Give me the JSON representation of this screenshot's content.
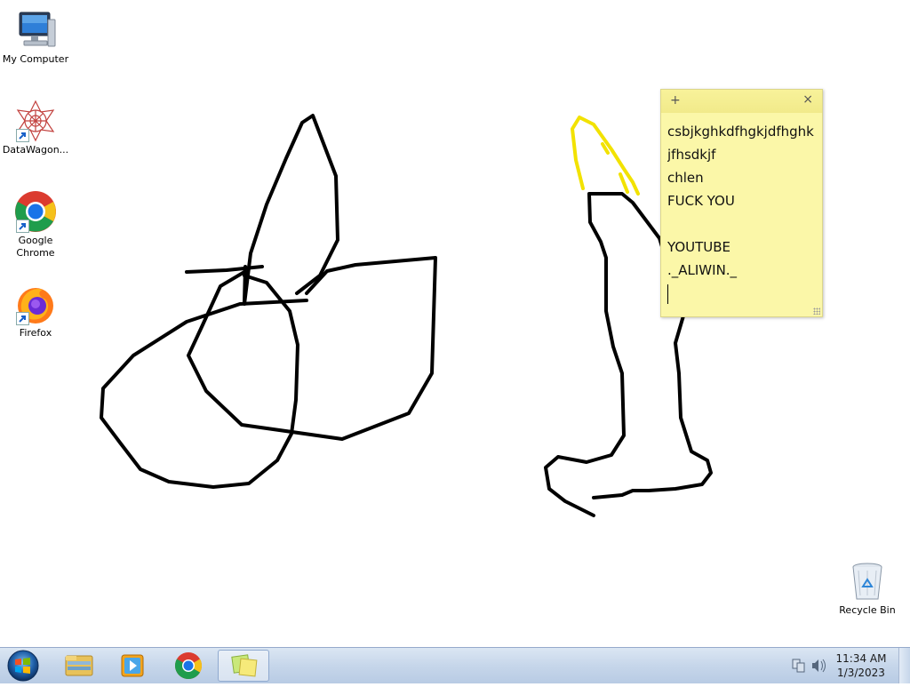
{
  "desktop": {
    "icons": [
      {
        "label": "My Computer",
        "icon": "computer-icon"
      },
      {
        "label": "DataWagon...",
        "icon": "datawagon-icon"
      },
      {
        "label": "Google Chrome",
        "icon": "chrome-icon"
      },
      {
        "label": "Firefox",
        "icon": "firefox-icon"
      },
      {
        "label": "Recycle Bin",
        "icon": "recycle-bin-icon"
      }
    ]
  },
  "sticky_note": {
    "add_symbol": "+",
    "close_symbol": "×",
    "lines": [
      "csbjkghkdfhgkjdfhghk",
      "jfhsdkjf",
      "chlen",
      "FUCK YOU",
      "",
      "YOUTUBE",
      "._ALIWIN._"
    ]
  },
  "taskbar": {
    "pinned": [
      {
        "name": "explorer",
        "icon": "folder-icon"
      },
      {
        "name": "media-player",
        "icon": "media-player-icon"
      },
      {
        "name": "chrome",
        "icon": "chrome-icon"
      },
      {
        "name": "sticky-notes",
        "icon": "sticky-notes-icon",
        "active": true
      }
    ],
    "clock": {
      "time": "11:34 AM",
      "date": "1/3/2023"
    }
  },
  "colors": {
    "taskbar": "#c6d6ea",
    "sticky": "#fbf7a8",
    "stroke": "#000000",
    "flame": "#f2e200"
  }
}
